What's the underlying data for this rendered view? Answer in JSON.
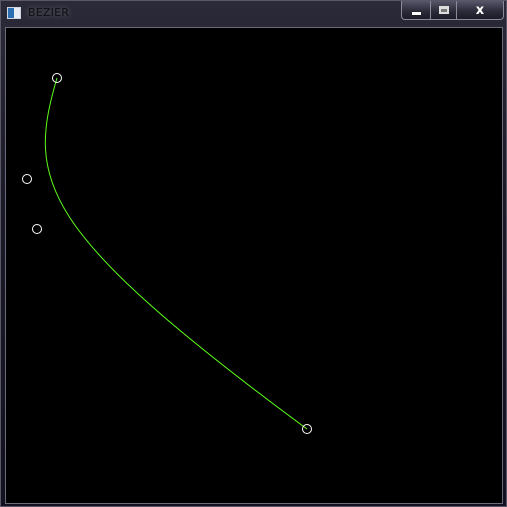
{
  "window": {
    "title": "BEZIER"
  },
  "caption_buttons": {
    "minimize_icon": "minimize-icon",
    "maximize_icon": "maximize-icon",
    "close_glyph": "x"
  },
  "canvas": {
    "background": "#000000",
    "curve_color": "#5cff1a",
    "point_color": "#ffffff"
  }
}
